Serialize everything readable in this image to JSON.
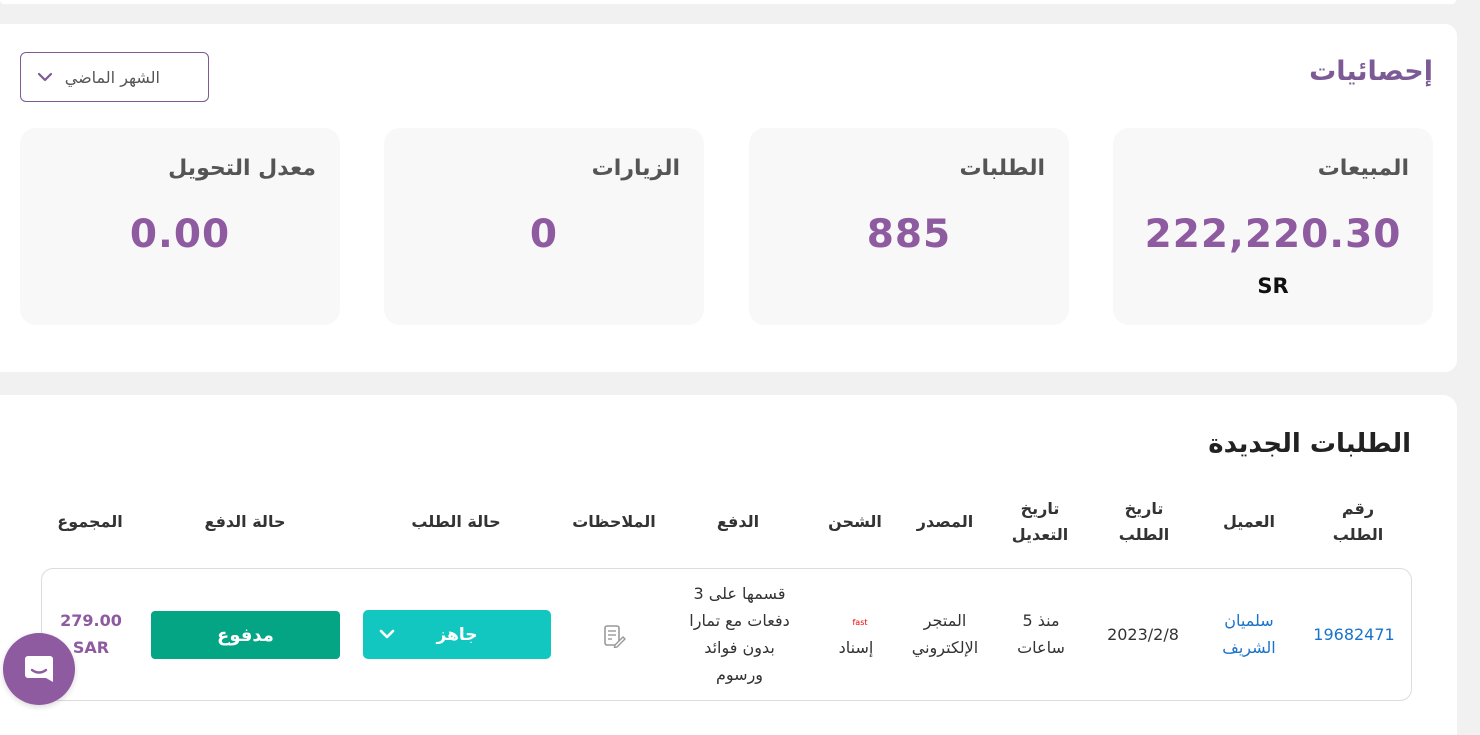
{
  "stats": {
    "title": "إحصائيات",
    "period": "الشهر الماضي",
    "cards": [
      {
        "label": "المبيعات",
        "value": "222,220.30",
        "unit": "SR"
      },
      {
        "label": "الطلبات",
        "value": "885",
        "unit": ""
      },
      {
        "label": "الزيارات",
        "value": "0",
        "unit": ""
      },
      {
        "label": "معدل التحويل",
        "value": "0.00",
        "unit": ""
      }
    ]
  },
  "orders": {
    "title": "الطلبات الجديدة",
    "headers": {
      "order_number": "رقم\nالطلب",
      "customer": "العميل",
      "order_date": "تاريخ\nالطلب",
      "modified_date": "تاريخ\nالتعديل",
      "source": "المصدر",
      "shipping": "الشحن",
      "payment": "الدفع",
      "notes": "الملاحظات",
      "order_status": "حالة الطلب",
      "payment_status": "حالة الدفع",
      "total": "المجموع"
    },
    "rows": [
      {
        "order_number": "19682471",
        "customer": "سلميان\nالشريف",
        "order_date": "2023/2/8",
        "modified_date": "منذ 5\nساعات",
        "source": "المتجر\nالإلكتروني",
        "shipping_logo": "fast",
        "shipping": "إسناد",
        "payment": "قسمها على 3\nدفعات مع تمارا\nبدون فوائد\nورسوم",
        "order_status": "جاهز",
        "payment_status": "مدفوع",
        "total": "279.00\nSAR"
      }
    ]
  },
  "colors": {
    "accent": "#8e5aa0",
    "status_ready": "#12c7c0",
    "paid": "#04a585",
    "link": "#1a73c9"
  },
  "icons": {
    "period_chevron": "chevron-down-icon",
    "notes": "note-edit-icon",
    "chat": "chat-icon"
  }
}
